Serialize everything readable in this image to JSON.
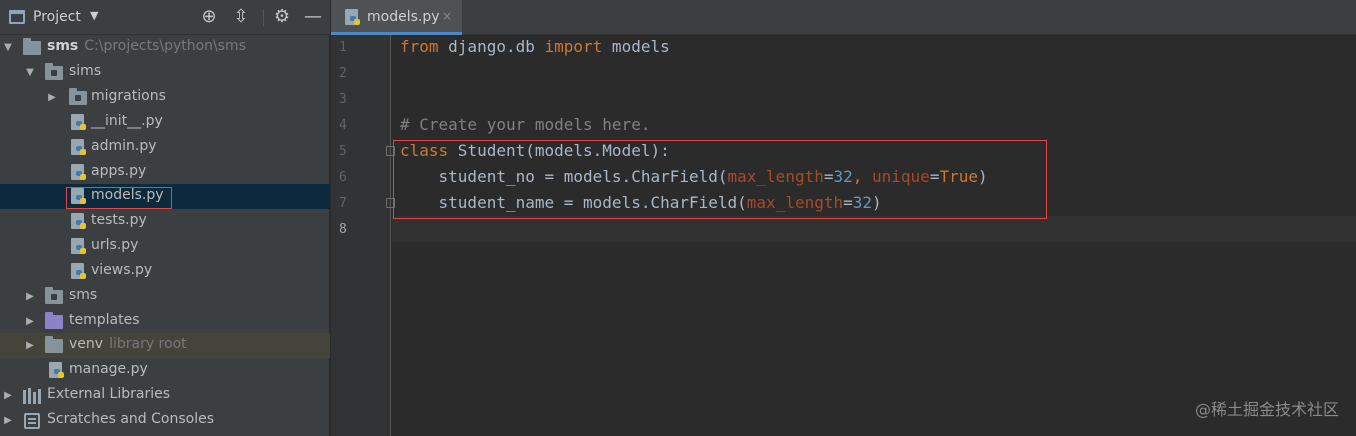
{
  "project_panel": {
    "title": "Project",
    "icons": [
      "project-panel-icon",
      "dropdown-arrow-icon",
      "locate-icon",
      "collapse-all-icon",
      "gear-icon",
      "minimize-icon"
    ],
    "tree": {
      "root_label": "sms",
      "root_path": "C:\\projects\\python\\sms",
      "app_folder": "sims",
      "migrations": "migrations",
      "init_file": "__init__.py",
      "admin_file": "admin.py",
      "apps_file": "apps.py",
      "models_file": "models.py",
      "tests_file": "tests.py",
      "urls_file": "urls.py",
      "views_file": "views.py",
      "sms_folder": "sms",
      "templates_folder": "templates",
      "venv_folder": "venv",
      "venv_sub": "library root",
      "manage_file": "manage.py",
      "external_libraries": "External Libraries",
      "scratches": "Scratches and Consoles"
    }
  },
  "editor": {
    "tab_label": "models.py",
    "tab_close": "×",
    "line_numbers": [
      "1",
      "2",
      "3",
      "4",
      "5",
      "6",
      "7",
      "8"
    ],
    "code": {
      "l1_from": "from",
      "l1_module": " django.db ",
      "l1_import": "import",
      "l1_models": " models",
      "l4_comment": "# Create your models here.",
      "l5_class": "class",
      "l5_rest": " Student(models.Model):",
      "l6_a": "    student_no = models.CharField(",
      "l6_p1": "max_length",
      "l6_eq1": "=",
      "l6_n1": "32",
      "l6_comma": ", ",
      "l6_p2": "unique",
      "l6_eq2": "=",
      "l6_true": "True",
      "l6_close": ")",
      "l7_a": "    student_name = models.CharField(",
      "l7_p1": "max_length",
      "l7_eq1": "=",
      "l7_n1": "32",
      "l7_close": ")"
    }
  },
  "watermark": "@稀土掘金技术社区",
  "colors": {
    "panel_bg": "#3c3f41",
    "editor_bg": "#2b2b2b",
    "selection": "#0d293e",
    "keyword": "#cc7832",
    "comment": "#808080",
    "number": "#6897bb",
    "param": "#aa4926",
    "highlight_box": "#e04848"
  }
}
